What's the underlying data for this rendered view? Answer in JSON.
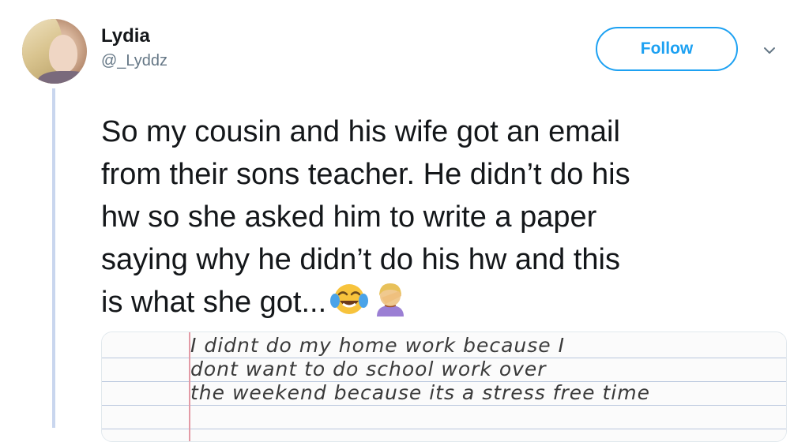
{
  "author": {
    "name": "Lydia",
    "handle": "@_Lyddz"
  },
  "actions": {
    "follow_label": "Follow",
    "more_icon": "chevron-down-icon"
  },
  "tweet": {
    "lines": [
      "So my cousin and his wife got an email",
      "from their sons teacher. He didn’t do his",
      "hw so she asked him to write a paper",
      "saying why he didn’t do his hw and this",
      "is what she got..."
    ],
    "emojis": [
      "face-with-tears-of-joy-emoji",
      "woman-facepalming-emoji"
    ]
  },
  "attachment": {
    "handwritten_lines": [
      "I didnt do my home work because I",
      "dont want to do school work over",
      "the weekend because its a stress free time"
    ]
  },
  "colors": {
    "accent": "#1da1f2",
    "text": "#14171a",
    "muted": "#657786",
    "thread_line": "#c9d6ee"
  }
}
